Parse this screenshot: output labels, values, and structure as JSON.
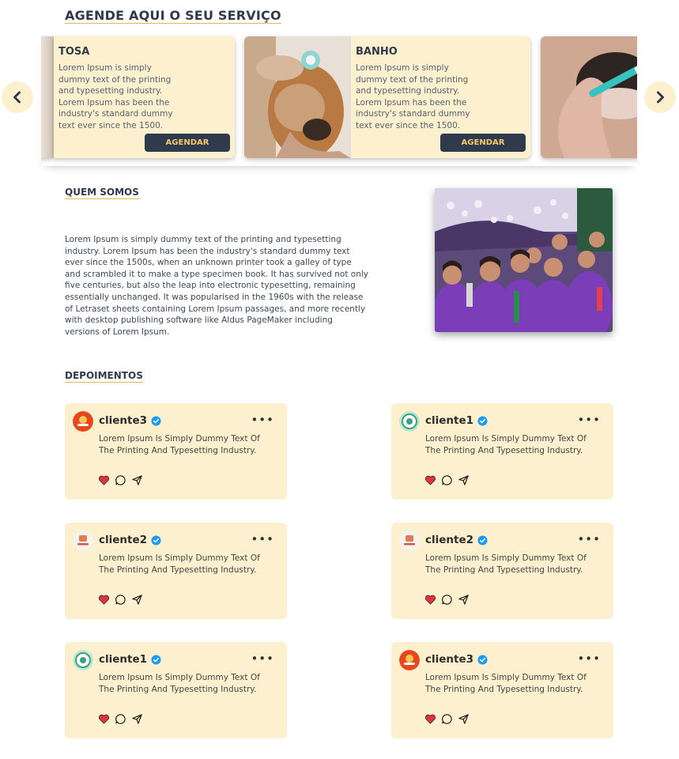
{
  "agende": {
    "title": "AGENDE AQUI O SEU SERVIÇO",
    "services": [
      {
        "name": "TOSA",
        "description": "Lorem Ipsum is simply dummy text of the printing and typesetting industry. Lorem Ipsum has been the industry's standard dummy text ever since the 1500.",
        "button": "AGENDAR"
      },
      {
        "name": "BANHO",
        "description": "Lorem Ipsum is simply dummy text of the printing and typesetting industry. Lorem Ipsum has been the industry's standard dummy text ever since the 1500.",
        "button": "AGENDAR"
      }
    ],
    "prev_icon": "chevron-left-icon",
    "next_icon": "chevron-right-icon"
  },
  "quem_somos": {
    "title": "QUEM SOMOS",
    "text": "Lorem Ipsum is simply dummy text of the printing and typesetting industry. Lorem Ipsum has been the industry's standard dummy text ever since the 1500s, when an unknown printer took a galley of type and scrambled it to make a type specimen book. It has survived not only five centuries, but also the leap into electronic typesetting, remaining essentially unchanged. It was popularised in the 1960s with the release of Letraset sheets containing Lorem Ipsum passages, and more recently with desktop publishing software like Aldus PageMaker including versions of Lorem Ipsum."
  },
  "depoimentos": {
    "title": "DEPOIMENTOS",
    "items": [
      {
        "name": "cliente3",
        "text": "Lorem Ipsum Is Simply Dummy Text Of The Printing And Typesetting Industry."
      },
      {
        "name": "cliente1",
        "text": "Lorem Ipsum Is Simply Dummy Text Of The Printing And Typesetting Industry."
      },
      {
        "name": "cliente2",
        "text": "Lorem Ipsum Is Simply Dummy Text Of The Printing And Typesetting Industry."
      },
      {
        "name": "cliente2",
        "text": "Lorem Ipsum Is Simply Dummy Text Of The Printing And Typesetting Industry."
      },
      {
        "name": "cliente1",
        "text": "Lorem Ipsum Is Simply Dummy Text Of The Printing And Typesetting Industry."
      },
      {
        "name": "cliente3",
        "text": "Lorem Ipsum Is Simply Dummy Text Of The Printing And Typesetting Industry."
      }
    ]
  },
  "colors": {
    "navy": "#2f3b4c",
    "cream": "#fdf0cf",
    "gold": "#e4b84a",
    "heart": "#e0333f",
    "verified": "#1d9bf0"
  }
}
